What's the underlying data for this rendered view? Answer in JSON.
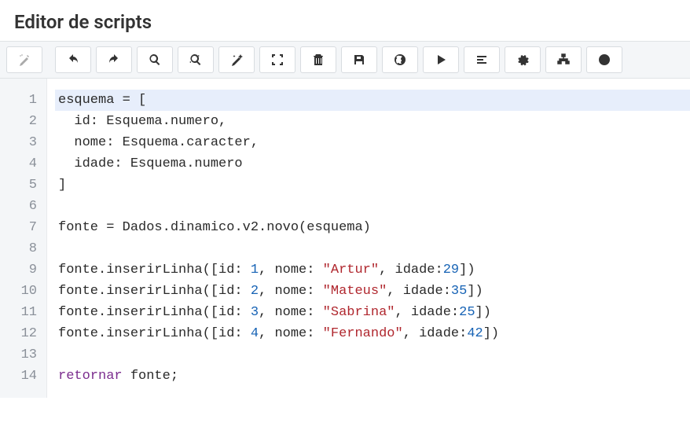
{
  "header": {
    "title": "Editor de scripts"
  },
  "toolbar": {
    "buttons": [
      {
        "name": "autofix",
        "muted": true
      },
      {
        "name": "undo"
      },
      {
        "name": "redo"
      },
      {
        "name": "search"
      },
      {
        "name": "replace"
      },
      {
        "name": "magic"
      },
      {
        "name": "fullscreen"
      },
      {
        "name": "delete"
      },
      {
        "name": "save"
      },
      {
        "name": "public"
      },
      {
        "name": "run"
      },
      {
        "name": "format"
      },
      {
        "name": "settings"
      },
      {
        "name": "tree"
      },
      {
        "name": "contrast"
      }
    ]
  },
  "code": {
    "line_count": 14,
    "lines": [
      {
        "n": 1,
        "hl": true,
        "tokens": [
          [
            "ident",
            "esquema"
          ],
          [
            "plain",
            " = ["
          ]
        ]
      },
      {
        "n": 2,
        "tokens": [
          [
            "plain",
            "  id: Esquema.numero,"
          ]
        ]
      },
      {
        "n": 3,
        "tokens": [
          [
            "plain",
            "  nome: Esquema.caracter,"
          ]
        ]
      },
      {
        "n": 4,
        "tokens": [
          [
            "plain",
            "  idade: Esquema.numero"
          ]
        ]
      },
      {
        "n": 5,
        "tokens": [
          [
            "plain",
            "]"
          ]
        ]
      },
      {
        "n": 6,
        "tokens": []
      },
      {
        "n": 7,
        "tokens": [
          [
            "ident",
            "fonte"
          ],
          [
            "plain",
            " = Dados.dinamico.v2.novo(esquema)"
          ]
        ]
      },
      {
        "n": 8,
        "tokens": []
      },
      {
        "n": 9,
        "tokens": [
          [
            "plain",
            "fonte.inserirLinha([id: "
          ],
          [
            "num",
            "1"
          ],
          [
            "plain",
            ", nome: "
          ],
          [
            "str",
            "\"Artur\""
          ],
          [
            "plain",
            ", idade:"
          ],
          [
            "num",
            "29"
          ],
          [
            "plain",
            "])"
          ]
        ]
      },
      {
        "n": 10,
        "tokens": [
          [
            "plain",
            "fonte.inserirLinha([id: "
          ],
          [
            "num",
            "2"
          ],
          [
            "plain",
            ", nome: "
          ],
          [
            "str",
            "\"Mateus\""
          ],
          [
            "plain",
            ", idade:"
          ],
          [
            "num",
            "35"
          ],
          [
            "plain",
            "])"
          ]
        ]
      },
      {
        "n": 11,
        "tokens": [
          [
            "plain",
            "fonte.inserirLinha([id: "
          ],
          [
            "num",
            "3"
          ],
          [
            "plain",
            ", nome: "
          ],
          [
            "str",
            "\"Sabrina\""
          ],
          [
            "plain",
            ", idade:"
          ],
          [
            "num",
            "25"
          ],
          [
            "plain",
            "])"
          ]
        ]
      },
      {
        "n": 12,
        "tokens": [
          [
            "plain",
            "fonte.inserirLinha([id: "
          ],
          [
            "num",
            "4"
          ],
          [
            "plain",
            ", nome: "
          ],
          [
            "str",
            "\"Fernando\""
          ],
          [
            "plain",
            ", idade:"
          ],
          [
            "num",
            "42"
          ],
          [
            "plain",
            "])"
          ]
        ]
      },
      {
        "n": 13,
        "tokens": []
      },
      {
        "n": 14,
        "tokens": [
          [
            "kw",
            "retornar"
          ],
          [
            "plain",
            " fonte;"
          ]
        ]
      }
    ]
  }
}
